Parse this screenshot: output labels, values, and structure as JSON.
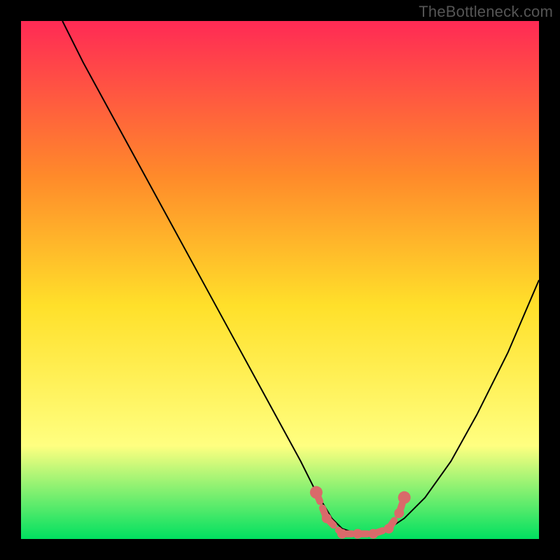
{
  "watermark": "TheBottleneck.com",
  "chart_data": {
    "type": "line",
    "title": "",
    "xlabel": "",
    "ylabel": "",
    "xlim": [
      0,
      100
    ],
    "ylim": [
      0,
      100
    ],
    "background_gradient": {
      "top": "#ff2a55",
      "mid1": "#ff8a2a",
      "mid2": "#ffe02a",
      "lower": "#ffff80",
      "bottom": "#00e060"
    },
    "series": [
      {
        "name": "bottleneck-curve",
        "color": "#000000",
        "x": [
          8,
          12,
          18,
          24,
          30,
          36,
          42,
          48,
          54,
          57,
          60,
          62,
          65,
          68,
          71,
          74,
          78,
          83,
          88,
          94,
          100
        ],
        "y": [
          100,
          92,
          81,
          70,
          59,
          48,
          37,
          26,
          15,
          9,
          4,
          2,
          1,
          1,
          2,
          4,
          8,
          15,
          24,
          36,
          50
        ]
      }
    ],
    "highlight": {
      "name": "optimal-band",
      "color": "#d96a6a",
      "points_x": [
        57,
        59,
        62,
        65,
        68,
        71,
        73,
        74
      ],
      "points_y": [
        9,
        4,
        1,
        1,
        1,
        2,
        5,
        8
      ]
    }
  }
}
